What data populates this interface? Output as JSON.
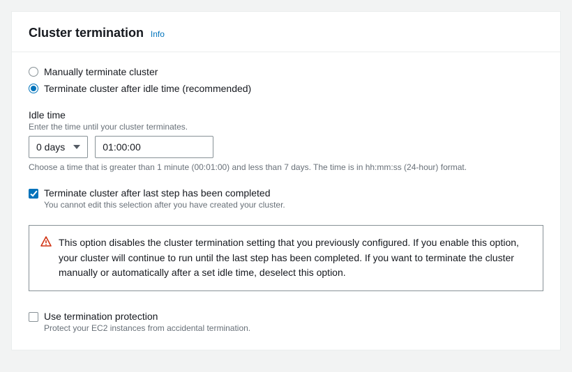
{
  "header": {
    "title": "Cluster termination",
    "info_label": "Info"
  },
  "termination_mode": {
    "options": [
      {
        "label": "Manually terminate cluster"
      },
      {
        "label": "Terminate cluster after idle time (recommended)"
      }
    ],
    "selected_index": 1
  },
  "idle_time": {
    "label": "Idle time",
    "hint": "Enter the time until your cluster terminates.",
    "days_value": "0 days",
    "duration_value": "01:00:00",
    "constraint": "Choose a time that is greater than 1 minute (00:01:00) and less than 7 days. The time is in hh:mm:ss (24-hour) format."
  },
  "terminate_after_step": {
    "label": "Terminate cluster after last step has been completed",
    "desc": "You cannot edit this selection after you have created your cluster.",
    "checked": true
  },
  "alert": {
    "text": "This option disables the cluster termination setting that you previously configured. If you enable this option, your cluster will continue to run until the last step has been completed. If you want to terminate the cluster manually or automatically after a set idle time, deselect this option."
  },
  "termination_protection": {
    "label": "Use termination protection",
    "desc": "Protect your EC2 instances from accidental termination.",
    "checked": false
  }
}
